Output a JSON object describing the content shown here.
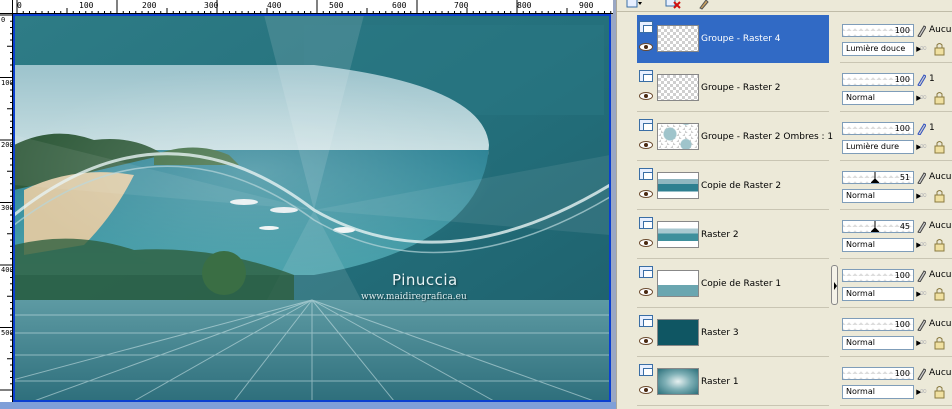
{
  "rulers": {
    "top_labels": [
      "0",
      "100",
      "200",
      "300",
      "400",
      "500",
      "600",
      "700",
      "800",
      "900"
    ],
    "left_labels": [
      "0",
      "100",
      "200",
      "300",
      "400",
      "500"
    ]
  },
  "watermark": {
    "name": "Pinuccia",
    "url": "www.maidiregrafica.eu"
  },
  "layers": [
    {
      "name": "Groupe - Raster 4",
      "selected": true,
      "thumb": "checker",
      "opacity": "100",
      "mode": "Lumière douce",
      "extra": "Aucu"
    },
    {
      "name": "Groupe - Raster 2",
      "selected": false,
      "thumb": "checker",
      "opacity": "100",
      "mode": "Normal",
      "extra": "1"
    },
    {
      "name": "Groupe - Raster 2 Ombres : 1",
      "selected": false,
      "thumb": "shadow",
      "opacity": "100",
      "mode": "Lumière dure",
      "extra": "1"
    },
    {
      "name": "Copie de Raster 2",
      "selected": false,
      "thumb": "beach",
      "opacity": "51",
      "mode": "Normal",
      "extra": "Aucu"
    },
    {
      "name": "Raster 2",
      "selected": false,
      "thumb": "beach2",
      "opacity": "45",
      "mode": "Normal",
      "extra": "Aucu"
    },
    {
      "name": "Copie de Raster 1",
      "selected": false,
      "thumb": "grid",
      "opacity": "100",
      "mode": "Normal",
      "extra": "Aucu"
    },
    {
      "name": "Raster 3",
      "selected": false,
      "thumb": "teal",
      "opacity": "100",
      "mode": "Normal",
      "extra": "Aucu"
    },
    {
      "name": "Raster 1",
      "selected": false,
      "thumb": "radial",
      "opacity": "100",
      "mode": "Normal",
      "extra": "Aucu"
    }
  ],
  "colors": {
    "selection": "#316ac5",
    "canvas_bg": "#2b6f7a",
    "raster3": "#0f5663"
  }
}
